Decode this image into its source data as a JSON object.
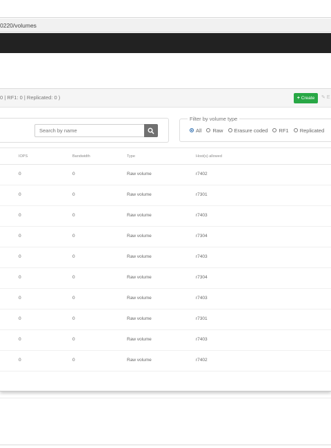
{
  "url": {
    "path": "0220/volumes"
  },
  "panel": {
    "summary": "0 | RF1: 0 | Replicated: 0 )",
    "create_label": "Create",
    "edit_label": "E"
  },
  "search": {
    "placeholder": "Search by name"
  },
  "filter": {
    "legend": "Filter by volume type",
    "options": [
      "All",
      "Raw",
      "Erasure coded",
      "RF1",
      "Replicated"
    ],
    "selected": "All"
  },
  "table": {
    "headers": [
      "IOPS",
      "Bandwidth",
      "Type",
      "Host(s) allowed"
    ],
    "rows": [
      {
        "iops": "0",
        "bandwidth": "0",
        "type": "Raw volume",
        "hosts": "r7402"
      },
      {
        "iops": "0",
        "bandwidth": "0",
        "type": "Raw volume",
        "hosts": "r7301"
      },
      {
        "iops": "0",
        "bandwidth": "0",
        "type": "Raw volume",
        "hosts": "r7403"
      },
      {
        "iops": "0",
        "bandwidth": "0",
        "type": "Raw volume",
        "hosts": "r7304"
      },
      {
        "iops": "0",
        "bandwidth": "0",
        "type": "Raw volume",
        "hosts": "r7403"
      },
      {
        "iops": "0",
        "bandwidth": "0",
        "type": "Raw volume",
        "hosts": "r7304"
      },
      {
        "iops": "0",
        "bandwidth": "0",
        "type": "Raw volume",
        "hosts": "r7403"
      },
      {
        "iops": "0",
        "bandwidth": "0",
        "type": "Raw volume",
        "hosts": "r7301"
      },
      {
        "iops": "0",
        "bandwidth": "0",
        "type": "Raw volume",
        "hosts": "r7403"
      },
      {
        "iops": "0",
        "bandwidth": "0",
        "type": "Raw volume",
        "hosts": "r7402"
      }
    ]
  },
  "colors": {
    "navbar": "#222222",
    "create": "#28a745",
    "radio_selected": "#2b6cb0"
  },
  "icons": {
    "search": "search-icon",
    "create": "plus-icon",
    "edit": "pencil-icon"
  }
}
